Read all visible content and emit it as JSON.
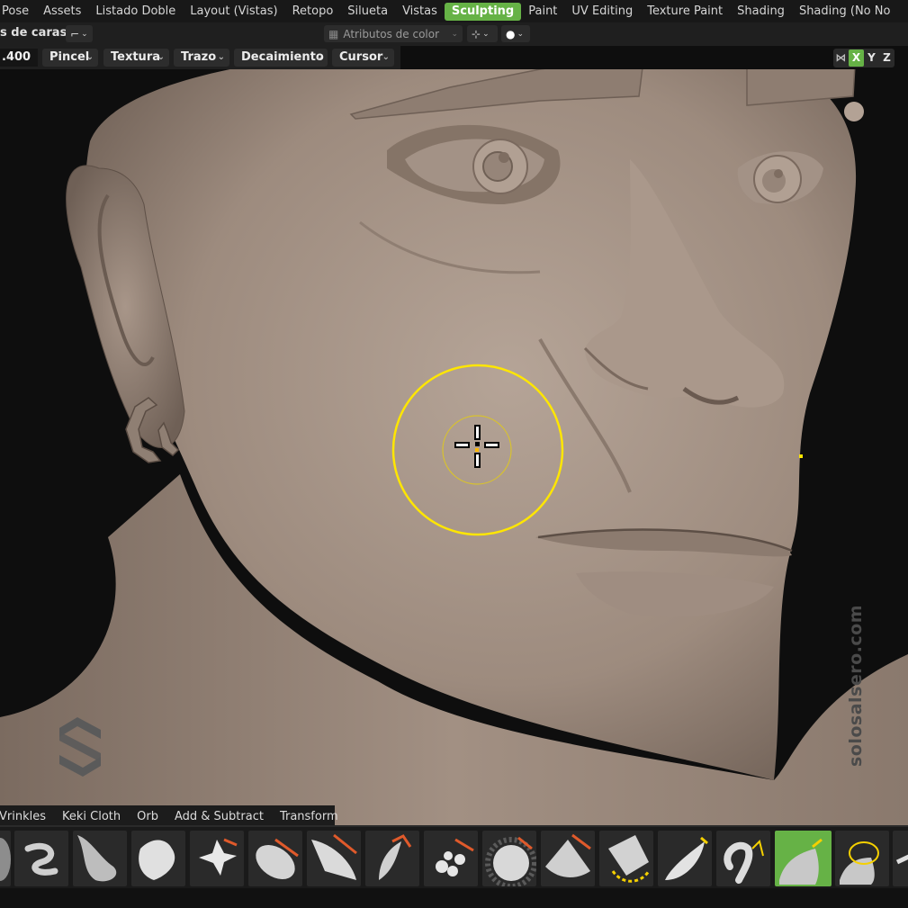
{
  "workspace_tabs": [
    "Pose",
    "Assets",
    "Listado Doble",
    "Layout (Vistas)",
    "Retopo",
    "Silueta",
    "Vistas",
    "Sculpting",
    "Paint",
    "UV Editing",
    "Texture Paint",
    "Shading",
    "Shading (No No"
  ],
  "active_tab": "Sculpting",
  "header": {
    "mode_label": "s de caras",
    "attributes_label": "Atributos de color"
  },
  "tool_settings": {
    "value": ".400",
    "menus": [
      "Pincel",
      "Textura",
      "Trazo",
      "Decaimiento",
      "Cursor"
    ]
  },
  "axis": [
    "X",
    "Y",
    "Z"
  ],
  "active_axis": "X",
  "watermark": "solosalsero.com",
  "brush_tabs": [
    "Vrinkles",
    "Keki Cloth",
    "Orb",
    "Add & Subtract",
    "Transform"
  ],
  "brushes": [
    "Draw",
    "Blob",
    "Inflate",
    "Crease",
    "Pinch",
    "Flatten",
    "Fill",
    "Scrape",
    "Clay",
    "Clay Strips",
    "Layer",
    "Rotate",
    "Grab",
    "Snake Hook",
    "Elastic",
    "Pose"
  ],
  "colors": {
    "accent": "#66b246",
    "cursor": "#ffe600",
    "skin": "#a59385",
    "background": "#0e0e0e"
  }
}
